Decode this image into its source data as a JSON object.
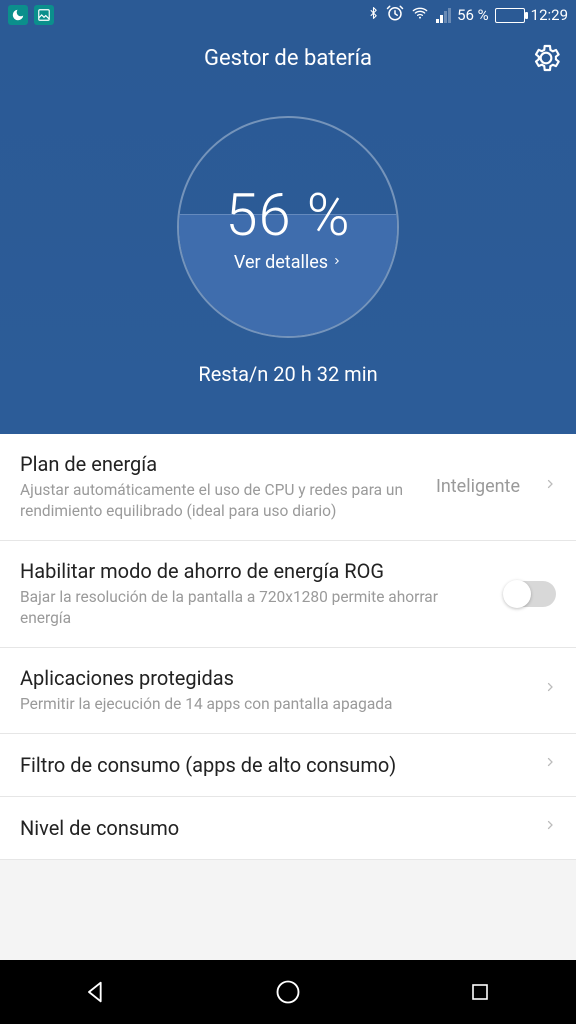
{
  "status": {
    "battery_pct": "56 %",
    "time": "12:29"
  },
  "header": {
    "title": "Gestor de batería"
  },
  "gauge": {
    "percent": "56 %",
    "details_link": "Ver detalles",
    "remaining": "Resta/n 20 h 32 min"
  },
  "settings": {
    "power_plan": {
      "title": "Plan de energía",
      "sub": "Ajustar automáticamente el uso de CPU y redes para un rendimiento equilibrado (ideal para uso diario)",
      "value": "Inteligente"
    },
    "rog": {
      "title": "Habilitar modo de ahorro de energía ROG",
      "sub": "Bajar la resolución de la pantalla a 720x1280 permite ahorrar energía",
      "enabled": false
    },
    "protected_apps": {
      "title": "Aplicaciones protegidas",
      "sub": "Permitir la ejecución de 14 apps con pantalla apagada"
    },
    "consumption_filter": {
      "title": "Filtro de consumo (apps de alto consumo)"
    },
    "consumption_level": {
      "title": "Nivel de consumo"
    }
  }
}
